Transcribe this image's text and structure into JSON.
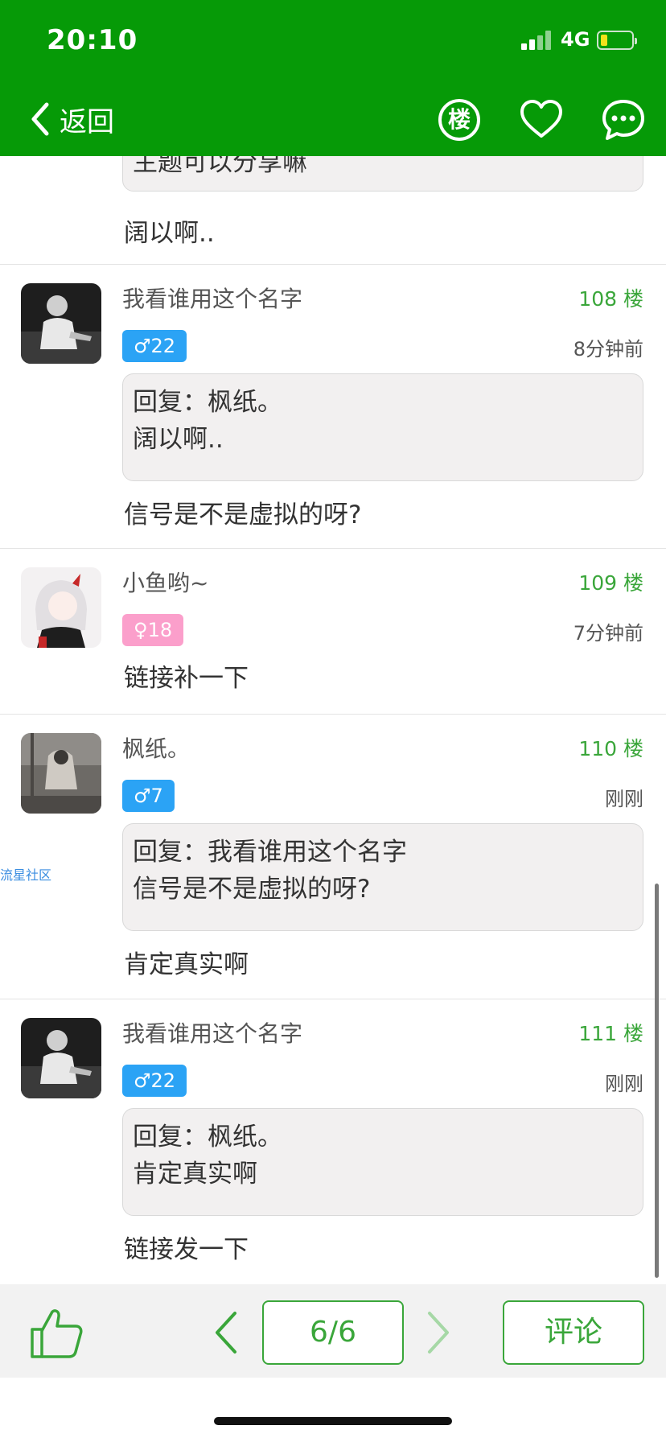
{
  "status": {
    "time": "20:10",
    "network": "4G"
  },
  "header": {
    "back_label": "返回",
    "floor_icon_text": "楼"
  },
  "top_partial": {
    "quoted_fragment": "主题可以分享嘛",
    "content": "阔以啊.."
  },
  "posts": [
    {
      "username": "我看谁用这个名字",
      "floor": "108 楼",
      "badge": "♂22",
      "gender": "male",
      "time": "8分钟前",
      "reply_line1": "回复：枫纸。",
      "reply_line2": "阔以啊..",
      "content": "信号是不是虚拟的呀?"
    },
    {
      "username": "小鱼哟~",
      "floor": "109 楼",
      "badge": "♀18",
      "gender": "female",
      "time": "7分钟前",
      "content": "链接补一下"
    },
    {
      "username": "枫纸。",
      "floor": "110 楼",
      "badge": "♂7",
      "gender": "male",
      "time": "刚刚",
      "reply_line1": "回复：我看谁用这个名字",
      "reply_line2": "信号是不是虚拟的呀?",
      "content": "肯定真实啊"
    },
    {
      "username": "我看谁用这个名字",
      "floor": "111 楼",
      "badge": "♂22",
      "gender": "male",
      "time": "刚刚",
      "reply_line1": "回复：枫纸。",
      "reply_line2": "肯定真实啊",
      "content": "链接发一下"
    }
  ],
  "watermark": "流星社区",
  "footer": {
    "page_indicator": "6/6",
    "comment_label": "评论"
  },
  "colors": {
    "header_green": "#069a07",
    "accent_green": "#3aa63a",
    "male_badge": "#2ba3f5",
    "female_badge": "#fb9fcb"
  },
  "icons": [
    "chevron-left-icon",
    "floor-icon",
    "heart-icon",
    "chat-bubble-icon",
    "thumbs-up-icon",
    "chevron-right-icon"
  ]
}
